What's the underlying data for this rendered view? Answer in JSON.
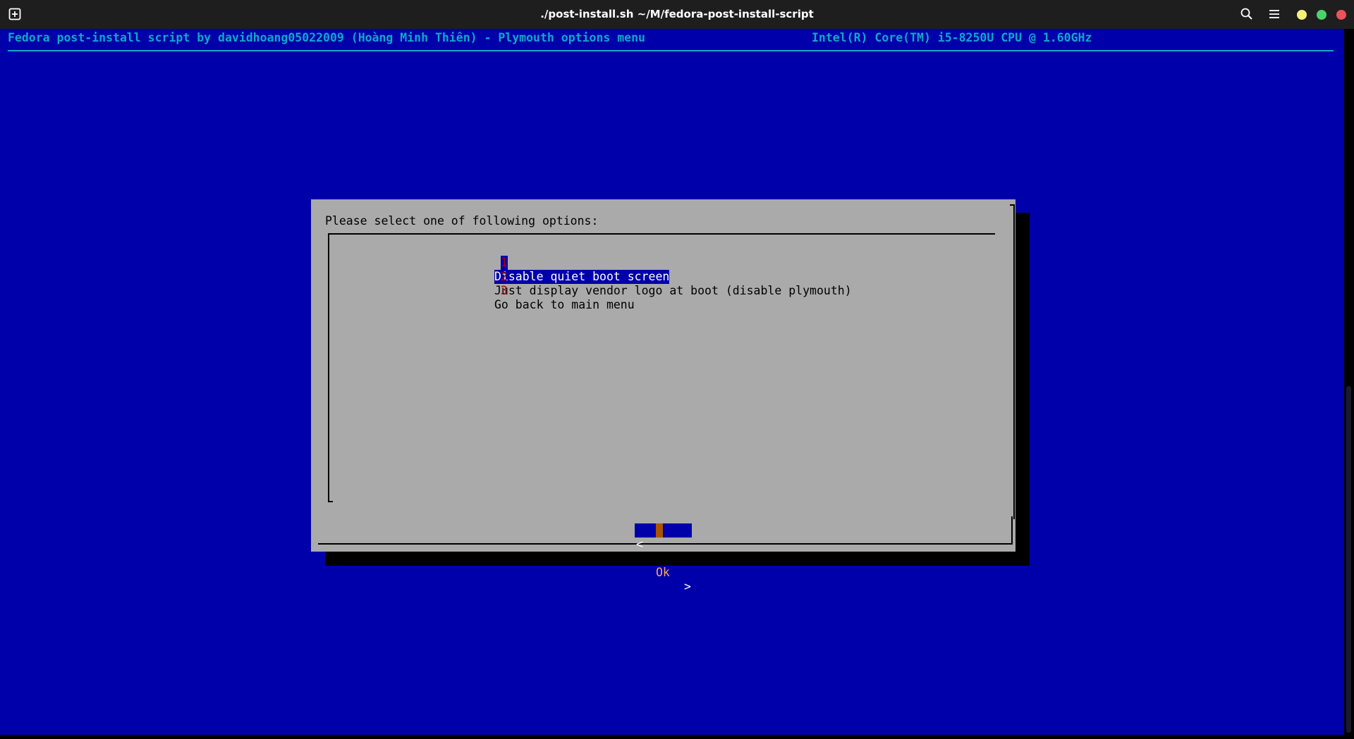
{
  "window": {
    "title": "./post-install.sh ~/M/fedora-post-install-script"
  },
  "titlebar_icons": {
    "new_tab": "new-tab-icon",
    "search": "search-icon",
    "menu": "hamburger-menu-icon"
  },
  "window_controls": {
    "minimize_color": "#f4f07a",
    "maximize_color": "#4bd26b",
    "close_color": "#f0505a"
  },
  "header": {
    "left": "Fedora post-install script by davidhoang05022009 (Hoàng Minh Thiên) - Plymouth options menu",
    "right": "Intel(R) Core(TM) i5-8250U CPU @ 1.60GHz"
  },
  "dialog": {
    "prompt": "Please select one of following options:",
    "items": [
      {
        "tag": "1",
        "label": "Disable quiet boot screen",
        "selected": true
      },
      {
        "tag": "2",
        "label": "Just display vendor logo at boot (disable plymouth)",
        "selected": false
      },
      {
        "tag": "3",
        "label": "Go back to main menu",
        "selected": false
      }
    ],
    "ok_button": {
      "left": "<",
      "label": "Ok",
      "right": ">"
    }
  },
  "colors": {
    "terminal_bg": "#0000aa",
    "header_text": "#12a6c9",
    "dialog_bg": "#aaaaaa",
    "tag_color": "#aa0000"
  }
}
